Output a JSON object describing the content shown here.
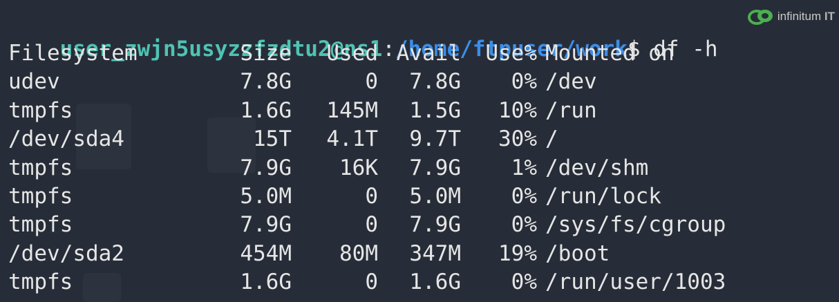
{
  "prompt": {
    "user_host": "user_zwjn5usyzzfzdtu2@ns1",
    "colon": ":",
    "path": "/home/ftpuser/work",
    "sign": "$",
    "command": " df -h"
  },
  "watermark": {
    "logo_name": "infinitum",
    "logo_suffix": "IT",
    "icon": "cloud-swirl-logo",
    "color": "#4caf50"
  },
  "table": {
    "headers": {
      "filesystem": "Filesystem",
      "size": "Size",
      "used": "Used",
      "avail": "Avail",
      "use_pct": "Use%",
      "mounted": "Mounted on"
    },
    "rows": [
      {
        "filesystem": "udev",
        "size": "7.8G",
        "used": "0",
        "avail": "7.8G",
        "use_pct": "0%",
        "mounted": "/dev"
      },
      {
        "filesystem": "tmpfs",
        "size": "1.6G",
        "used": "145M",
        "avail": "1.5G",
        "use_pct": "10%",
        "mounted": "/run"
      },
      {
        "filesystem": "/dev/sda4",
        "size": "15T",
        "used": "4.1T",
        "avail": "9.7T",
        "use_pct": "30%",
        "mounted": "/"
      },
      {
        "filesystem": "tmpfs",
        "size": "7.9G",
        "used": "16K",
        "avail": "7.9G",
        "use_pct": "1%",
        "mounted": "/dev/shm"
      },
      {
        "filesystem": "tmpfs",
        "size": "5.0M",
        "used": "0",
        "avail": "5.0M",
        "use_pct": "0%",
        "mounted": "/run/lock"
      },
      {
        "filesystem": "tmpfs",
        "size": "7.9G",
        "used": "0",
        "avail": "7.9G",
        "use_pct": "0%",
        "mounted": "/sys/fs/cgroup"
      },
      {
        "filesystem": "/dev/sda2",
        "size": "454M",
        "used": "80M",
        "avail": "347M",
        "use_pct": "19%",
        "mounted": "/boot"
      },
      {
        "filesystem": "tmpfs",
        "size": "1.6G",
        "used": "0",
        "avail": "1.6G",
        "use_pct": "0%",
        "mounted": "/run/user/1003"
      }
    ]
  },
  "colors": {
    "background": "#272d38",
    "prompt_user": "#4fc3b4",
    "prompt_path": "#3b8eea",
    "text": "#e6e6e6"
  }
}
